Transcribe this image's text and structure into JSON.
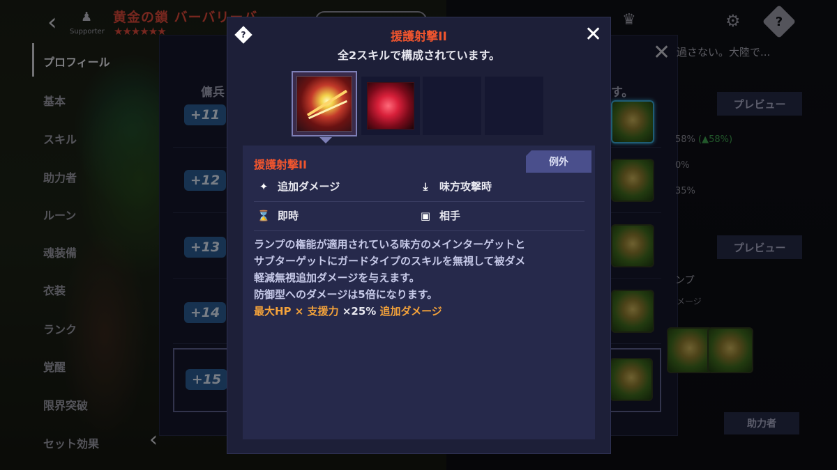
{
  "header": {
    "back_icon": "back-arrow-icon",
    "title": "黄金の鎖 バーバリーバ",
    "role": "Supporter",
    "stars": "★★★★★★"
  },
  "sidebar": {
    "items": [
      {
        "label": "プロフィール",
        "active": true
      },
      {
        "label": "基本"
      },
      {
        "label": "スキル"
      },
      {
        "label": "助力者"
      },
      {
        "label": "ルーン"
      },
      {
        "label": "魂装備"
      },
      {
        "label": "衣装"
      },
      {
        "label": "ランク"
      },
      {
        "label": "覚醒"
      },
      {
        "label": "限界突破"
      },
      {
        "label": "セット効果"
      }
    ]
  },
  "sub_panel": {
    "header_left": "傭兵",
    "header_right": "す。",
    "description_fragment": "過さない。大陸で...",
    "levels": [
      "+11",
      "+12",
      "+13",
      "+14",
      "+15"
    ],
    "selected_level": "+15",
    "preview_label": "プレビュー",
    "stats": [
      {
        "value": "58%",
        "delta": "(▲58%)"
      },
      {
        "value": "0%"
      },
      {
        "value": "35%"
      }
    ],
    "side_text_1": "ンプ",
    "side_text_2": "メージ",
    "helper_label": "助力者"
  },
  "modal": {
    "title": "援護射撃II",
    "subtitle": "全2スキルで構成されています。",
    "close_icon": "close-icon",
    "help_icon": "help-icon",
    "skill_slots": [
      {
        "icon": "support-shot-skill-icon",
        "selected": true
      },
      {
        "icon": "red-book-skill-icon",
        "selected": false
      },
      {
        "empty": true
      },
      {
        "empty": true
      }
    ],
    "detail": {
      "name": "援護射撃II",
      "tag": "例外",
      "attributes": [
        {
          "icon": "sparkle-icon",
          "label": "追加ダメージ"
        },
        {
          "icon": "download-arrow-icon",
          "label": "味方攻撃時"
        },
        {
          "icon": "hourglass-icon",
          "label": "即時"
        },
        {
          "icon": "target-frame-icon",
          "label": "相手"
        }
      ],
      "description_lines": [
        "ランプの権能が適用されている味方のメインターゲットと",
        "サブターゲットにガードタイプのスキルを無視して被ダメ",
        "軽減無視追加ダメージを与えます。",
        "防御型へのダメージは5倍になります。"
      ],
      "formula": {
        "part1": "最大HP",
        "op1": " × ",
        "part2": "支援力",
        "mult": " ×25% ",
        "part3": "追加ダメージ"
      }
    }
  }
}
